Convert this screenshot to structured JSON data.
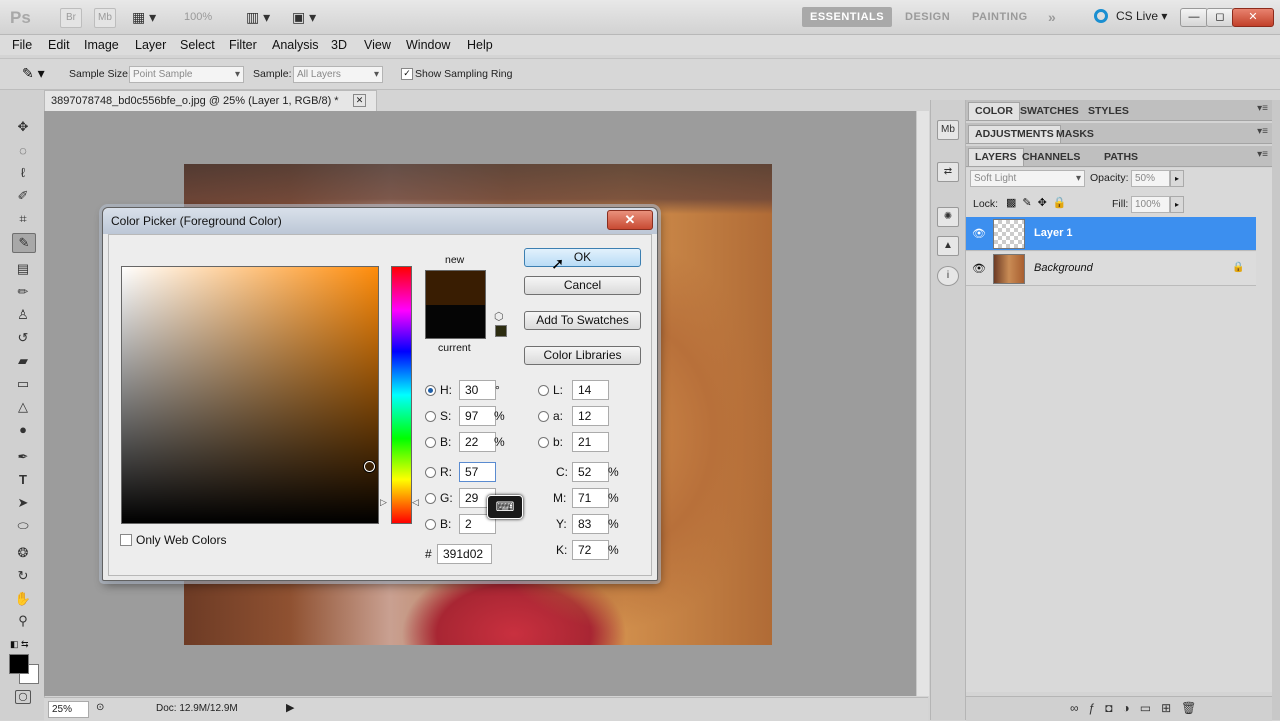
{
  "app": {
    "logo": "Ps",
    "bridge_btn": "Br",
    "minibridge_btn": "Mb",
    "zoom_display": "100%",
    "workspaces": [
      "ESSENTIALS",
      "DESIGN",
      "PAINTING"
    ],
    "more_workspaces": "»",
    "cs_live": "CS Live",
    "window_buttons": [
      "—",
      "◻",
      "✕"
    ]
  },
  "menubar": [
    "File",
    "Edit",
    "Image",
    "Layer",
    "Select",
    "Filter",
    "Analysis",
    "3D",
    "View",
    "Window",
    "Help"
  ],
  "options": {
    "sample_size_label": "Sample Size:",
    "sample_size_value": "Point Sample",
    "sample_label": "Sample:",
    "sample_value": "All Layers",
    "sampling_ring_label": "Show Sampling Ring",
    "sampling_ring_checked": true
  },
  "document": {
    "tab_title": "3897078748_bd0c556bfe_o.jpg @ 25% (Layer 1, RGB/8) *",
    "tab_close": "✕"
  },
  "status": {
    "zoom": "25%",
    "doc_size": "Doc: 12.9M/12.9M"
  },
  "panels": {
    "group1_tabs": [
      "COLOR",
      "SWATCHES",
      "STYLES"
    ],
    "group2_tabs": [
      "ADJUSTMENTS",
      "MASKS"
    ],
    "group3_tabs": [
      "LAYERS",
      "CHANNELS",
      "PATHS"
    ],
    "blend_mode": "Soft Light",
    "opacity_label": "Opacity:",
    "opacity_value": "50%",
    "lock_label": "Lock:",
    "fill_label": "Fill:",
    "fill_value": "100%",
    "layers": [
      {
        "name": "Layer 1",
        "selected": true
      },
      {
        "name": "Background",
        "selected": false,
        "locked": true
      }
    ]
  },
  "dialog": {
    "title": "Color Picker (Foreground Color)",
    "close": "✕",
    "new_label": "new",
    "current_label": "current",
    "new_color": "#391d02",
    "current_color": "#050505",
    "buttons": {
      "ok": "OK",
      "cancel": "Cancel",
      "add_swatches": "Add To Swatches",
      "color_libraries": "Color Libraries"
    },
    "fields": {
      "H": {
        "label": "H:",
        "value": "30",
        "unit": "°",
        "selected": true
      },
      "S": {
        "label": "S:",
        "value": "97",
        "unit": "%"
      },
      "B": {
        "label": "B:",
        "value": "22",
        "unit": "%"
      },
      "R": {
        "label": "R:",
        "value": "57"
      },
      "G": {
        "label": "G:",
        "value": "29"
      },
      "Bl": {
        "label": "B:",
        "value": "2"
      },
      "L": {
        "label": "L:",
        "value": "14"
      },
      "a": {
        "label": "a:",
        "value": "12"
      },
      "b": {
        "label": "b:",
        "value": "21"
      },
      "C": {
        "label": "C:",
        "value": "52",
        "unit": "%"
      },
      "M": {
        "label": "M:",
        "value": "71",
        "unit": "%"
      },
      "Y": {
        "label": "Y:",
        "value": "83",
        "unit": "%"
      },
      "K": {
        "label": "K:",
        "value": "72",
        "unit": "%"
      }
    },
    "hex_label": "#",
    "hex_value": "391d02",
    "only_web_colors": "Only Web Colors"
  }
}
